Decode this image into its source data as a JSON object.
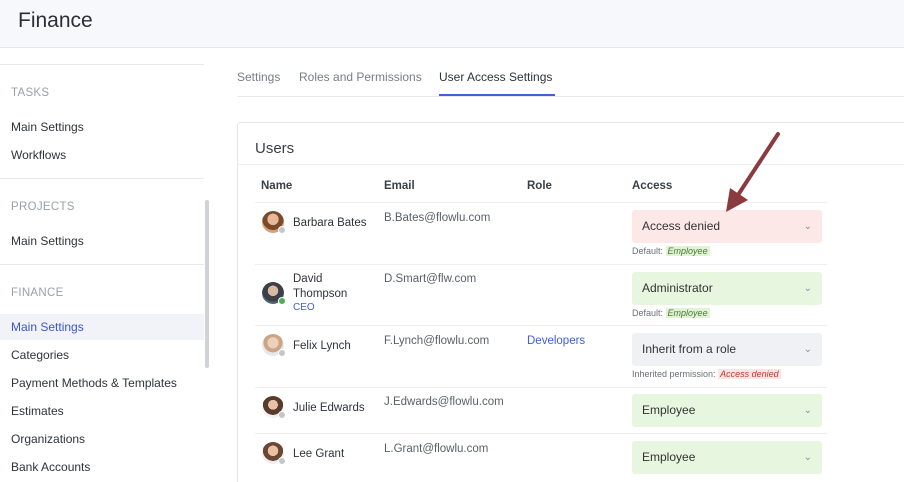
{
  "app": {
    "title": "Finance"
  },
  "sidebar": {
    "sections": [
      {
        "title": "TASKS",
        "items": [
          "Main Settings",
          "Workflows"
        ]
      },
      {
        "title": "PROJECTS",
        "items": [
          "Main Settings"
        ]
      },
      {
        "title": "FINANCE",
        "items": [
          "Main Settings",
          "Categories",
          "Payment Methods & Templates",
          "Estimates",
          "Organizations",
          "Bank Accounts"
        ]
      }
    ],
    "active_item": "Finance / Main Settings"
  },
  "tabs": [
    {
      "label": "Settings",
      "active": false
    },
    {
      "label": "Roles and Permissions",
      "active": false
    },
    {
      "label": "User Access Settings",
      "active": true
    }
  ],
  "users_card": {
    "title": "Users",
    "columns": [
      "Name",
      "Email",
      "Role",
      "Access"
    ],
    "rows": [
      {
        "name": "Barbara Bates",
        "subtitle": "",
        "email": "B.Bates@flowlu.com",
        "role": "",
        "access": "Access denied",
        "access_style": "denied",
        "hint_prefix": "Default:",
        "hint_value": "Employee",
        "hint_style": "green",
        "online": false
      },
      {
        "name": "David Thompson",
        "subtitle": "CEO",
        "email": "D.Smart@flw.com",
        "role": "",
        "access": "Administrator",
        "access_style": "granted",
        "hint_prefix": "Default:",
        "hint_value": "Employee",
        "hint_style": "green",
        "online": true
      },
      {
        "name": "Felix Lynch",
        "subtitle": "",
        "email": "F.Lynch@flowlu.com",
        "role": "Developers",
        "access": "Inherit from a role",
        "access_style": "inherit",
        "hint_prefix": "Inherited permission:",
        "hint_value": "Access denied",
        "hint_style": "red",
        "online": false
      },
      {
        "name": "Julie Edwards",
        "subtitle": "",
        "email": "J.Edwards@flowlu.com",
        "role": "",
        "access": "Employee",
        "access_style": "granted",
        "hint_prefix": "",
        "hint_value": "",
        "hint_style": "",
        "online": false
      },
      {
        "name": "Lee Grant",
        "subtitle": "",
        "email": "L.Grant@flowlu.com",
        "role": "",
        "access": "Employee",
        "access_style": "granted",
        "hint_prefix": "",
        "hint_value": "",
        "hint_style": "",
        "online": false
      }
    ]
  },
  "colors": {
    "accent": "#4060d8",
    "denied_bg": "#fde8e8",
    "granted_bg": "#e7f6df",
    "inherit_bg": "#f0f1f5",
    "annotation_arrow": "#8b3a3f"
  },
  "icons": {
    "dropdown": "chevron-down-icon"
  }
}
